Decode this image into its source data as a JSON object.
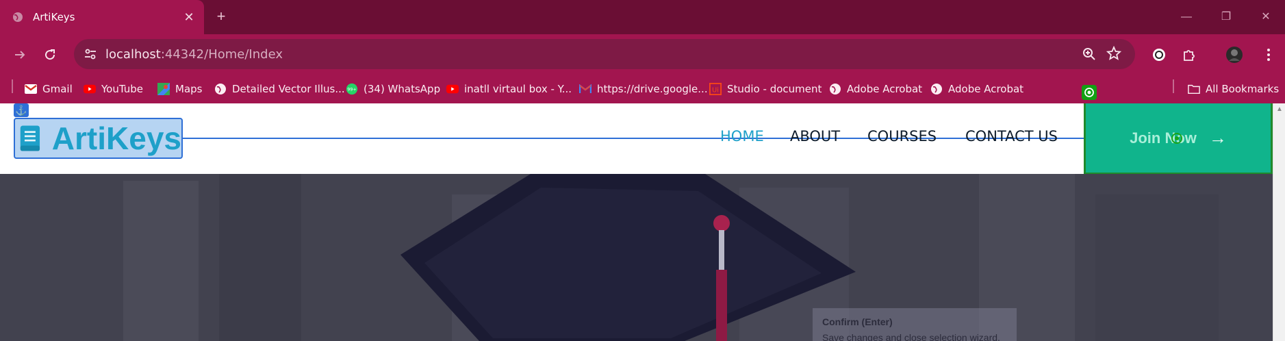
{
  "browser": {
    "tab_title": "ArtiKeys",
    "tab_close": "✕",
    "new_tab": "+",
    "url_host": "localhost",
    "url_rest": ":44342/Home/Index",
    "window_controls": {
      "minimize": "—",
      "restore": "❐",
      "close": "✕"
    }
  },
  "bookmarks": [
    {
      "label": "Gmail",
      "icon": "gmail-icon"
    },
    {
      "label": "YouTube",
      "icon": "youtube-icon"
    },
    {
      "label": "Maps",
      "icon": "maps-icon"
    },
    {
      "label": "Detailed Vector Illus...",
      "icon": "globe-icon"
    },
    {
      "label": "(34) WhatsApp",
      "icon": "whatsapp-icon"
    },
    {
      "label": "inatll virtaul box - Y...",
      "icon": "youtube-icon"
    },
    {
      "label": "https://drive.google...",
      "icon": "gmail-icon"
    },
    {
      "label": "Studio - document",
      "icon": "uipath-icon"
    },
    {
      "label": "Adobe Acrobat",
      "icon": "globe-icon"
    },
    {
      "label": "Adobe Acrobat",
      "icon": "globe-icon"
    }
  ],
  "all_bookmarks": "All Bookmarks",
  "site": {
    "brand": "ArtiKeys",
    "nav": [
      "HOME",
      "ABOUT",
      "COURSES",
      "CONTACT US"
    ],
    "join_label": "Join Now",
    "join_arrow": "→"
  },
  "tooltip": {
    "title": "Confirm (Enter)",
    "body": "Save changes and close selection wizard."
  },
  "colors": {
    "chrome_dark": "#6a0e34",
    "chrome": "#a2154f",
    "accent": "#1ea0c9",
    "join_bg": "#10b48c",
    "selection": "#2e6fd6"
  }
}
